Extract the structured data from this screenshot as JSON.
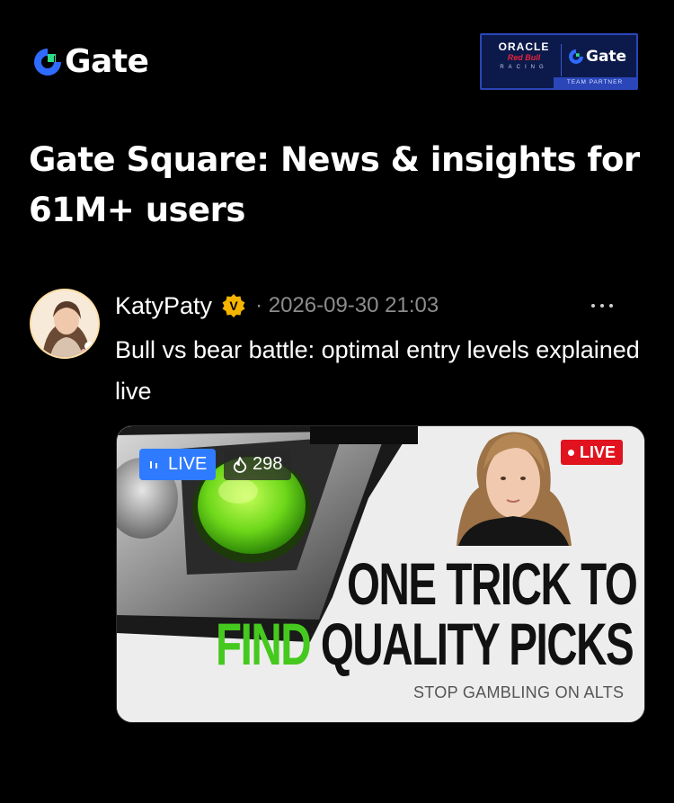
{
  "header": {
    "brand_name": "Gate",
    "partner_badge": {
      "oracle": "ORACLE",
      "redbull": "Red Bull",
      "racing": "RACING",
      "gate": "Gate",
      "footer": "TEAM PARTNER"
    }
  },
  "headline": "Gate Square: News & insights for 61M+ users",
  "post": {
    "author": "KatyPaty",
    "verified_badge_letter": "V",
    "timestamp": "· 2026-09-30 21:03",
    "title": "Bull vs bear battle: optimal entry levels explained live",
    "thumbnail": {
      "live_label": "LIVE",
      "viewer_count": "298",
      "corner_live": "LIVE",
      "line1": "ONE TRICK TO",
      "line2_green": "FIND",
      "line2_rest": " QUALITY PICKS",
      "subline": "STOP GAMBLING ON ALTS"
    }
  },
  "colors": {
    "background": "#000000",
    "accent_blue": "#2f7bff",
    "verified_gold": "#f5b400",
    "live_red": "#e0131e",
    "highlight_green": "#45c91e"
  },
  "icons": [
    "gate-logo-icon",
    "verified-icon",
    "more-icon",
    "live-bars-icon",
    "flame-icon"
  ]
}
